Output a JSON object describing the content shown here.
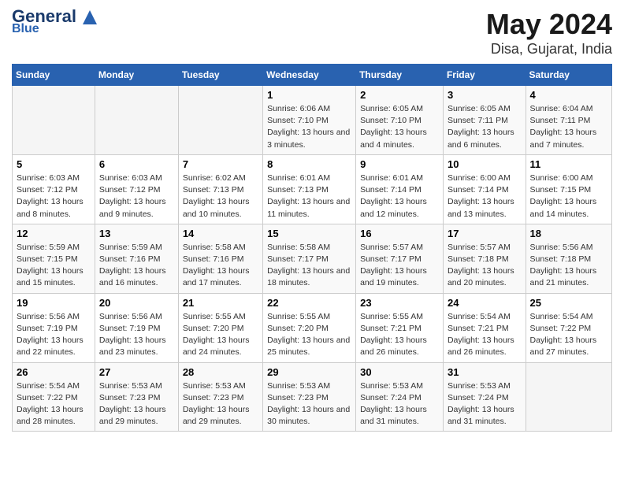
{
  "header": {
    "logo_line1": "General",
    "logo_line2": "Blue",
    "title": "May 2024",
    "subtitle": "Disa, Gujarat, India"
  },
  "weekdays": [
    "Sunday",
    "Monday",
    "Tuesday",
    "Wednesday",
    "Thursday",
    "Friday",
    "Saturday"
  ],
  "weeks": [
    [
      {
        "day": "",
        "sunrise": "",
        "sunset": "",
        "daylight": ""
      },
      {
        "day": "",
        "sunrise": "",
        "sunset": "",
        "daylight": ""
      },
      {
        "day": "",
        "sunrise": "",
        "sunset": "",
        "daylight": ""
      },
      {
        "day": "1",
        "sunrise": "Sunrise: 6:06 AM",
        "sunset": "Sunset: 7:10 PM",
        "daylight": "Daylight: 13 hours and 3 minutes."
      },
      {
        "day": "2",
        "sunrise": "Sunrise: 6:05 AM",
        "sunset": "Sunset: 7:10 PM",
        "daylight": "Daylight: 13 hours and 4 minutes."
      },
      {
        "day": "3",
        "sunrise": "Sunrise: 6:05 AM",
        "sunset": "Sunset: 7:11 PM",
        "daylight": "Daylight: 13 hours and 6 minutes."
      },
      {
        "day": "4",
        "sunrise": "Sunrise: 6:04 AM",
        "sunset": "Sunset: 7:11 PM",
        "daylight": "Daylight: 13 hours and 7 minutes."
      }
    ],
    [
      {
        "day": "5",
        "sunrise": "Sunrise: 6:03 AM",
        "sunset": "Sunset: 7:12 PM",
        "daylight": "Daylight: 13 hours and 8 minutes."
      },
      {
        "day": "6",
        "sunrise": "Sunrise: 6:03 AM",
        "sunset": "Sunset: 7:12 PM",
        "daylight": "Daylight: 13 hours and 9 minutes."
      },
      {
        "day": "7",
        "sunrise": "Sunrise: 6:02 AM",
        "sunset": "Sunset: 7:13 PM",
        "daylight": "Daylight: 13 hours and 10 minutes."
      },
      {
        "day": "8",
        "sunrise": "Sunrise: 6:01 AM",
        "sunset": "Sunset: 7:13 PM",
        "daylight": "Daylight: 13 hours and 11 minutes."
      },
      {
        "day": "9",
        "sunrise": "Sunrise: 6:01 AM",
        "sunset": "Sunset: 7:14 PM",
        "daylight": "Daylight: 13 hours and 12 minutes."
      },
      {
        "day": "10",
        "sunrise": "Sunrise: 6:00 AM",
        "sunset": "Sunset: 7:14 PM",
        "daylight": "Daylight: 13 hours and 13 minutes."
      },
      {
        "day": "11",
        "sunrise": "Sunrise: 6:00 AM",
        "sunset": "Sunset: 7:15 PM",
        "daylight": "Daylight: 13 hours and 14 minutes."
      }
    ],
    [
      {
        "day": "12",
        "sunrise": "Sunrise: 5:59 AM",
        "sunset": "Sunset: 7:15 PM",
        "daylight": "Daylight: 13 hours and 15 minutes."
      },
      {
        "day": "13",
        "sunrise": "Sunrise: 5:59 AM",
        "sunset": "Sunset: 7:16 PM",
        "daylight": "Daylight: 13 hours and 16 minutes."
      },
      {
        "day": "14",
        "sunrise": "Sunrise: 5:58 AM",
        "sunset": "Sunset: 7:16 PM",
        "daylight": "Daylight: 13 hours and 17 minutes."
      },
      {
        "day": "15",
        "sunrise": "Sunrise: 5:58 AM",
        "sunset": "Sunset: 7:17 PM",
        "daylight": "Daylight: 13 hours and 18 minutes."
      },
      {
        "day": "16",
        "sunrise": "Sunrise: 5:57 AM",
        "sunset": "Sunset: 7:17 PM",
        "daylight": "Daylight: 13 hours and 19 minutes."
      },
      {
        "day": "17",
        "sunrise": "Sunrise: 5:57 AM",
        "sunset": "Sunset: 7:18 PM",
        "daylight": "Daylight: 13 hours and 20 minutes."
      },
      {
        "day": "18",
        "sunrise": "Sunrise: 5:56 AM",
        "sunset": "Sunset: 7:18 PM",
        "daylight": "Daylight: 13 hours and 21 minutes."
      }
    ],
    [
      {
        "day": "19",
        "sunrise": "Sunrise: 5:56 AM",
        "sunset": "Sunset: 7:19 PM",
        "daylight": "Daylight: 13 hours and 22 minutes."
      },
      {
        "day": "20",
        "sunrise": "Sunrise: 5:56 AM",
        "sunset": "Sunset: 7:19 PM",
        "daylight": "Daylight: 13 hours and 23 minutes."
      },
      {
        "day": "21",
        "sunrise": "Sunrise: 5:55 AM",
        "sunset": "Sunset: 7:20 PM",
        "daylight": "Daylight: 13 hours and 24 minutes."
      },
      {
        "day": "22",
        "sunrise": "Sunrise: 5:55 AM",
        "sunset": "Sunset: 7:20 PM",
        "daylight": "Daylight: 13 hours and 25 minutes."
      },
      {
        "day": "23",
        "sunrise": "Sunrise: 5:55 AM",
        "sunset": "Sunset: 7:21 PM",
        "daylight": "Daylight: 13 hours and 26 minutes."
      },
      {
        "day": "24",
        "sunrise": "Sunrise: 5:54 AM",
        "sunset": "Sunset: 7:21 PM",
        "daylight": "Daylight: 13 hours and 26 minutes."
      },
      {
        "day": "25",
        "sunrise": "Sunrise: 5:54 AM",
        "sunset": "Sunset: 7:22 PM",
        "daylight": "Daylight: 13 hours and 27 minutes."
      }
    ],
    [
      {
        "day": "26",
        "sunrise": "Sunrise: 5:54 AM",
        "sunset": "Sunset: 7:22 PM",
        "daylight": "Daylight: 13 hours and 28 minutes."
      },
      {
        "day": "27",
        "sunrise": "Sunrise: 5:53 AM",
        "sunset": "Sunset: 7:23 PM",
        "daylight": "Daylight: 13 hours and 29 minutes."
      },
      {
        "day": "28",
        "sunrise": "Sunrise: 5:53 AM",
        "sunset": "Sunset: 7:23 PM",
        "daylight": "Daylight: 13 hours and 29 minutes."
      },
      {
        "day": "29",
        "sunrise": "Sunrise: 5:53 AM",
        "sunset": "Sunset: 7:23 PM",
        "daylight": "Daylight: 13 hours and 30 minutes."
      },
      {
        "day": "30",
        "sunrise": "Sunrise: 5:53 AM",
        "sunset": "Sunset: 7:24 PM",
        "daylight": "Daylight: 13 hours and 31 minutes."
      },
      {
        "day": "31",
        "sunrise": "Sunrise: 5:53 AM",
        "sunset": "Sunset: 7:24 PM",
        "daylight": "Daylight: 13 hours and 31 minutes."
      },
      {
        "day": "",
        "sunrise": "",
        "sunset": "",
        "daylight": ""
      }
    ]
  ]
}
